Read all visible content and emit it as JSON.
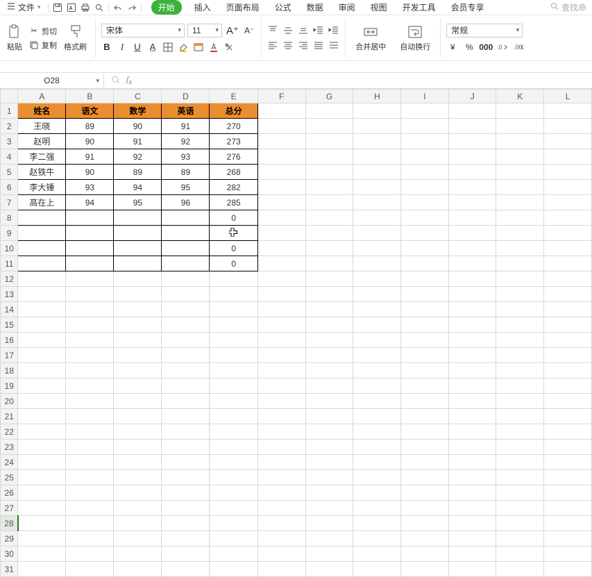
{
  "menu": {
    "file": "文件",
    "tabs": [
      "开始",
      "插入",
      "页面布局",
      "公式",
      "数据",
      "审阅",
      "视图",
      "开发工具",
      "会员专享"
    ],
    "active_tab_index": 0,
    "search_placeholder": "查找命"
  },
  "ribbon": {
    "paste": "粘贴",
    "cut": "剪切",
    "copy": "复制",
    "format_painter": "格式刷",
    "font_name": "宋体",
    "font_size": "11",
    "merge_center": "合并居中",
    "wrap_text": "自动换行",
    "number_format": "常规"
  },
  "name_box": {
    "cell_ref": "O28"
  },
  "columns": [
    "A",
    "B",
    "C",
    "D",
    "E",
    "F",
    "G",
    "H",
    "I",
    "J",
    "K",
    "L"
  ],
  "row_count": 31,
  "selected_row": 28,
  "cursor_cell": {
    "row": 9,
    "col": 5
  },
  "table": {
    "header": [
      "姓名",
      "语文",
      "数学",
      "英语",
      "总分"
    ],
    "rows": [
      [
        "王晓",
        "89",
        "90",
        "91",
        "270"
      ],
      [
        "赵明",
        "90",
        "91",
        "92",
        "273"
      ],
      [
        "李二强",
        "91",
        "92",
        "93",
        "276"
      ],
      [
        "赵铁牛",
        "90",
        "89",
        "89",
        "268"
      ],
      [
        "李大锤",
        "93",
        "94",
        "95",
        "282"
      ],
      [
        "高在上",
        "94",
        "95",
        "96",
        "285"
      ],
      [
        "",
        "",
        "",
        "",
        "0"
      ],
      [
        "",
        "",
        "",
        "",
        ""
      ],
      [
        "",
        "",
        "",
        "",
        "0"
      ],
      [
        "",
        "",
        "",
        "",
        "0"
      ]
    ]
  },
  "chart_data": {
    "type": "table",
    "title": "",
    "columns": [
      "姓名",
      "语文",
      "数学",
      "英语",
      "总分"
    ],
    "rows": [
      {
        "姓名": "王晓",
        "语文": 89,
        "数学": 90,
        "英语": 91,
        "总分": 270
      },
      {
        "姓名": "赵明",
        "语文": 90,
        "数学": 91,
        "英语": 92,
        "总分": 273
      },
      {
        "姓名": "李二强",
        "语文": 91,
        "数学": 92,
        "英语": 93,
        "总分": 276
      },
      {
        "姓名": "赵铁牛",
        "语文": 90,
        "数学": 89,
        "英语": 89,
        "总分": 268
      },
      {
        "姓名": "李大锤",
        "语文": 93,
        "数学": 94,
        "英语": 95,
        "总分": 282
      },
      {
        "姓名": "高在上",
        "语文": 94,
        "数学": 95,
        "英语": 96,
        "总分": 285
      }
    ]
  }
}
